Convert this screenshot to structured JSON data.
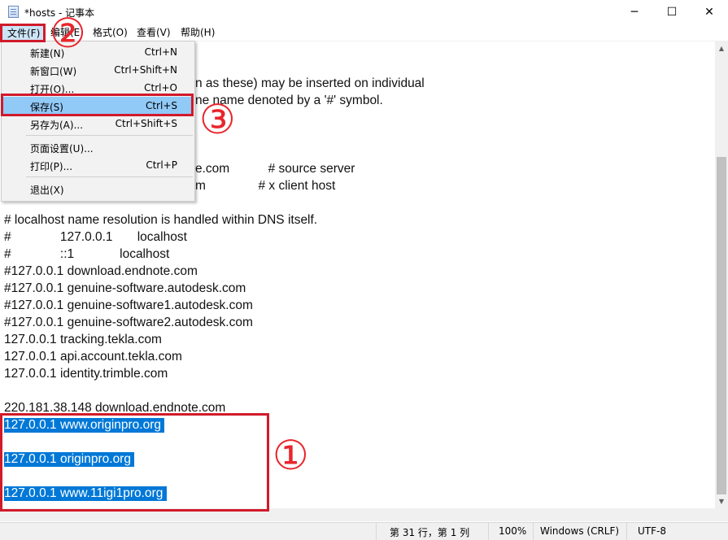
{
  "window": {
    "title": "*hosts - 记事本",
    "minimize_glyph": "─",
    "maximize_glyph": "☐",
    "close_glyph": "✕"
  },
  "menubar": {
    "file": "文件(F)",
    "edit": "编辑(E)",
    "format": "格式(O)",
    "view": "查看(V)",
    "help": "帮助(H)"
  },
  "file_menu": {
    "items": [
      {
        "label": "新建(N)",
        "shortcut": "Ctrl+N"
      },
      {
        "label": "新窗口(W)",
        "shortcut": "Ctrl+Shift+N"
      },
      {
        "label": "打开(O)...",
        "shortcut": "Ctrl+O"
      },
      {
        "label": "保存(S)",
        "shortcut": "Ctrl+S"
      },
      {
        "label": "另存为(A)...",
        "shortcut": "Ctrl+Shift+S"
      },
      {
        "label": "页面设置(U)...",
        "shortcut": ""
      },
      {
        "label": "打印(P)...",
        "shortcut": "Ctrl+P"
      },
      {
        "label": "退出(X)",
        "shortcut": ""
      }
    ]
  },
  "editor": {
    "lines": [
      "n as these) may be inserted on individual",
      "ne name denoted by a '#' symbol.",
      "e.com           # source server",
      "m               # x client host",
      "# localhost name resolution is handled within DNS itself.",
      "#              127.0.0.1       localhost",
      "#              ::1             localhost",
      "#127.0.0.1 download.endnote.com",
      "#127.0.0.1 genuine-software.autodesk.com",
      "#127.0.0.1 genuine-software1.autodesk.com",
      "#127.0.0.1 genuine-software2.autodesk.com",
      "127.0.0.1 tracking.tekla.com",
      "127.0.0.1 api.account.tekla.com",
      "127.0.0.1 identity.trimble.com",
      "220.181.38.148 download.endnote.com",
      "127.0.0.1 www.originpro.org ",
      "127.0.0.1 originpro.org ",
      "127.0.0.1 www.11igi1pro.org "
    ]
  },
  "statusbar": {
    "position": "第 31 行，第 1 列",
    "zoom": "100%",
    "line_ending": "Windows (CRLF)",
    "encoding": "UTF-8"
  },
  "annotations": {
    "step1": "①",
    "step2": "②",
    "step3": "③",
    "color": "#d11a2a"
  },
  "colors": {
    "selection": "#0078d7",
    "menu_highlight": "#91c9f7"
  }
}
